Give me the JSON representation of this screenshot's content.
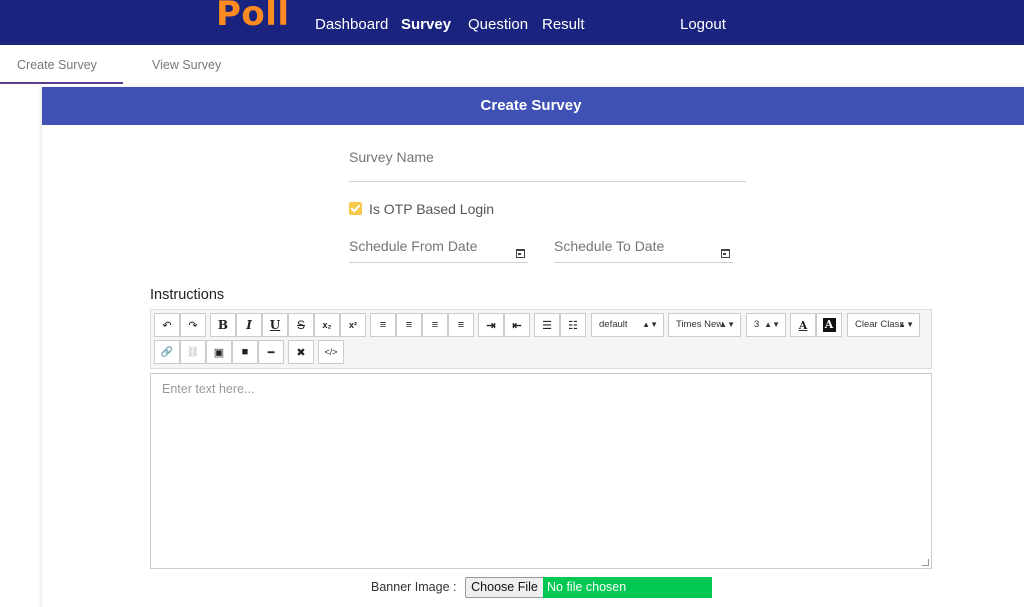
{
  "app": {
    "logo": "Poll"
  },
  "nav": {
    "items": [
      {
        "label": "Dashboard",
        "active": false
      },
      {
        "label": "Survey",
        "active": true
      },
      {
        "label": "Question",
        "active": false
      },
      {
        "label": "Result",
        "active": false
      }
    ],
    "logout": "Logout"
  },
  "subtabs": [
    {
      "label": "Create Survey",
      "active": true
    },
    {
      "label": "View Survey",
      "active": false
    }
  ],
  "form": {
    "header": "Create Survey",
    "survey_name_label": "Survey Name",
    "otp_label": "Is OTP Based Login",
    "otp_checked": true,
    "schedule_from_label": "Schedule From Date",
    "schedule_to_label": "Schedule To Date",
    "instructions_label": "Instructions",
    "editor_placeholder": "Enter text here...",
    "banner_label": "Banner Image :",
    "file_button": "Choose File",
    "file_status": "No file chosen"
  },
  "toolbar": {
    "font_size_select": "default",
    "font_family_select": "Times New",
    "size_select": "3",
    "clear_class_select": "Clear Class",
    "buttons": [
      {
        "icon": "undo-icon",
        "glyph": "↶"
      },
      {
        "icon": "redo-icon",
        "glyph": "↷"
      },
      {
        "icon": "bold-icon",
        "glyph": "B"
      },
      {
        "icon": "italic-icon",
        "glyph": "I"
      },
      {
        "icon": "underline-icon",
        "glyph": "U"
      },
      {
        "icon": "strikethrough-icon",
        "glyph": "S"
      },
      {
        "icon": "subscript-icon",
        "glyph": "x₂"
      },
      {
        "icon": "superscript-icon",
        "glyph": "x²"
      },
      {
        "icon": "align-left-icon",
        "glyph": "≡"
      },
      {
        "icon": "align-center-icon",
        "glyph": "≡"
      },
      {
        "icon": "align-right-icon",
        "glyph": "≡"
      },
      {
        "icon": "align-justify-icon",
        "glyph": "≡"
      },
      {
        "icon": "indent-icon",
        "glyph": "⇥"
      },
      {
        "icon": "outdent-icon",
        "glyph": "⇤"
      },
      {
        "icon": "bullet-list-icon",
        "glyph": "☰"
      },
      {
        "icon": "numbered-list-icon",
        "glyph": "☷"
      },
      {
        "icon": "text-color-icon",
        "glyph": "A"
      },
      {
        "icon": "background-color-icon",
        "glyph": "A"
      },
      {
        "icon": "link-icon",
        "glyph": "🔗"
      },
      {
        "icon": "unlink-icon",
        "glyph": "⛓"
      },
      {
        "icon": "image-icon",
        "glyph": "▣"
      },
      {
        "icon": "video-icon",
        "glyph": "■"
      },
      {
        "icon": "horizontal-rule-icon",
        "glyph": "━"
      },
      {
        "icon": "remove-format-icon",
        "glyph": "✖"
      },
      {
        "icon": "code-view-icon",
        "glyph": "</>"
      }
    ]
  },
  "colors": {
    "nav_bg": "#1a237e",
    "logo": "#ff8a1f",
    "card_header": "#3f51b5",
    "checkbox": "#f7c948",
    "file_status_bg": "#00c853"
  }
}
